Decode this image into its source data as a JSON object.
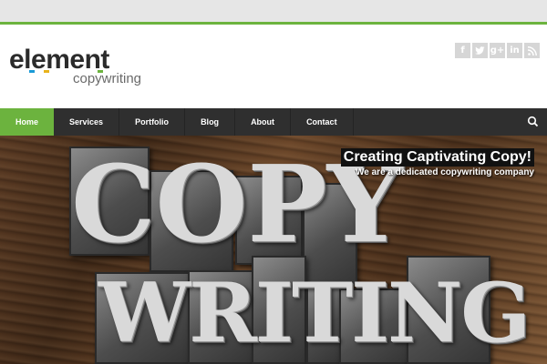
{
  "brand": {
    "name_left": "el",
    "name_e": "e",
    "name_m": "m",
    "name_e2": "e",
    "name_right": "nt",
    "tagline": "copywriting",
    "accent_colors": [
      "#1a9ad6",
      "#e8b21b",
      "#6cb33e"
    ]
  },
  "social": [
    {
      "icon": "facebook-icon",
      "glyph": "f"
    },
    {
      "icon": "twitter-icon",
      "glyph": "t"
    },
    {
      "icon": "google-plus-icon",
      "glyph": "g+"
    },
    {
      "icon": "linkedin-icon",
      "glyph": "in"
    },
    {
      "icon": "rss-icon",
      "glyph": "⊃"
    }
  ],
  "nav": {
    "items": [
      "Home",
      "Services",
      "Portfolio",
      "Blog",
      "About",
      "Contact"
    ],
    "active": "Home",
    "search_icon": "search-icon"
  },
  "hero": {
    "title": "Creating Captivating Copy!",
    "subtitle": "We are a dedicated copywriting company",
    "word1": "COPY",
    "word2": "WRITING"
  },
  "colors": {
    "accent": "#6cb33e",
    "nav_bg": "#2f2f2f"
  }
}
